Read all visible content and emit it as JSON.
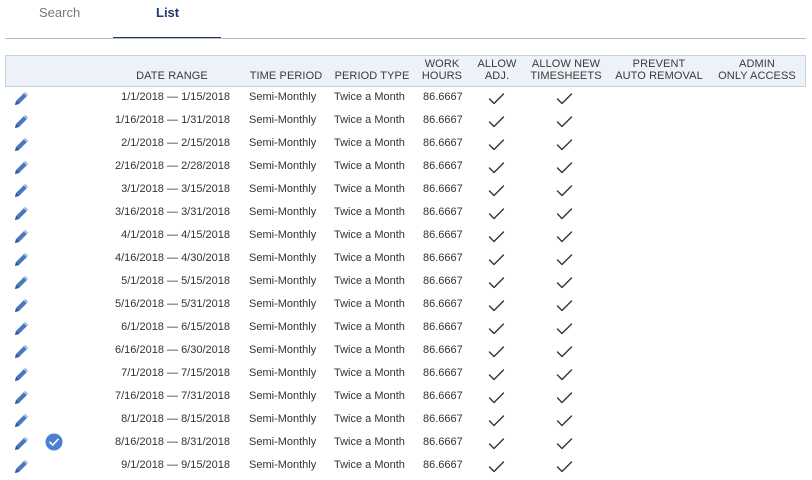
{
  "tabs": [
    {
      "label": "Search",
      "active": false
    },
    {
      "label": "List",
      "active": true
    }
  ],
  "columns": {
    "date_range": "DATE RANGE",
    "time_period": "TIME PERIOD",
    "period_type": "PERIOD TYPE",
    "work_hours": [
      "WORK",
      "HOURS"
    ],
    "allow_adj": [
      "ALLOW",
      "ADJ."
    ],
    "allow_new": [
      "ALLOW NEW",
      "TIMESHEETS"
    ],
    "prevent_auto": [
      "PREVENT",
      "AUTO REMOVAL"
    ],
    "admin_only": [
      "ADMIN",
      "ONLY ACCESS"
    ]
  },
  "colors": {
    "accent": "#1f3a6e",
    "edit_icon": "#4a78c0",
    "badge": "#4a7fd1",
    "header_bg": "#edf1f8"
  },
  "icons": {
    "edit": "pencil-icon",
    "check": "checkmark-icon",
    "badge": "check-circle-icon"
  },
  "rows": [
    {
      "start": "1/1/2018",
      "end": "1/15/2018",
      "period": "Semi-Monthly",
      "type": "Twice a Month",
      "hours": "86.6667",
      "adj": true,
      "new": true,
      "prevent": false,
      "admin": false,
      "badge": false
    },
    {
      "start": "1/16/2018",
      "end": "1/31/2018",
      "period": "Semi-Monthly",
      "type": "Twice a Month",
      "hours": "86.6667",
      "adj": true,
      "new": true,
      "prevent": false,
      "admin": false,
      "badge": false
    },
    {
      "start": "2/1/2018",
      "end": "2/15/2018",
      "period": "Semi-Monthly",
      "type": "Twice a Month",
      "hours": "86.6667",
      "adj": true,
      "new": true,
      "prevent": false,
      "admin": false,
      "badge": false
    },
    {
      "start": "2/16/2018",
      "end": "2/28/2018",
      "period": "Semi-Monthly",
      "type": "Twice a Month",
      "hours": "86.6667",
      "adj": true,
      "new": true,
      "prevent": false,
      "admin": false,
      "badge": false
    },
    {
      "start": "3/1/2018",
      "end": "3/15/2018",
      "period": "Semi-Monthly",
      "type": "Twice a Month",
      "hours": "86.6667",
      "adj": true,
      "new": true,
      "prevent": false,
      "admin": false,
      "badge": false
    },
    {
      "start": "3/16/2018",
      "end": "3/31/2018",
      "period": "Semi-Monthly",
      "type": "Twice a Month",
      "hours": "86.6667",
      "adj": true,
      "new": true,
      "prevent": false,
      "admin": false,
      "badge": false
    },
    {
      "start": "4/1/2018",
      "end": "4/15/2018",
      "period": "Semi-Monthly",
      "type": "Twice a Month",
      "hours": "86.6667",
      "adj": true,
      "new": true,
      "prevent": false,
      "admin": false,
      "badge": false
    },
    {
      "start": "4/16/2018",
      "end": "4/30/2018",
      "period": "Semi-Monthly",
      "type": "Twice a Month",
      "hours": "86.6667",
      "adj": true,
      "new": true,
      "prevent": false,
      "admin": false,
      "badge": false
    },
    {
      "start": "5/1/2018",
      "end": "5/15/2018",
      "period": "Semi-Monthly",
      "type": "Twice a Month",
      "hours": "86.6667",
      "adj": true,
      "new": true,
      "prevent": false,
      "admin": false,
      "badge": false
    },
    {
      "start": "5/16/2018",
      "end": "5/31/2018",
      "period": "Semi-Monthly",
      "type": "Twice a Month",
      "hours": "86.6667",
      "adj": true,
      "new": true,
      "prevent": false,
      "admin": false,
      "badge": false
    },
    {
      "start": "6/1/2018",
      "end": "6/15/2018",
      "period": "Semi-Monthly",
      "type": "Twice a Month",
      "hours": "86.6667",
      "adj": true,
      "new": true,
      "prevent": false,
      "admin": false,
      "badge": false
    },
    {
      "start": "6/16/2018",
      "end": "6/30/2018",
      "period": "Semi-Monthly",
      "type": "Twice a Month",
      "hours": "86.6667",
      "adj": true,
      "new": true,
      "prevent": false,
      "admin": false,
      "badge": false
    },
    {
      "start": "7/1/2018",
      "end": "7/15/2018",
      "period": "Semi-Monthly",
      "type": "Twice a Month",
      "hours": "86.6667",
      "adj": true,
      "new": true,
      "prevent": false,
      "admin": false,
      "badge": false
    },
    {
      "start": "7/16/2018",
      "end": "7/31/2018",
      "period": "Semi-Monthly",
      "type": "Twice a Month",
      "hours": "86.6667",
      "adj": true,
      "new": true,
      "prevent": false,
      "admin": false,
      "badge": false
    },
    {
      "start": "8/1/2018",
      "end": "8/15/2018",
      "period": "Semi-Monthly",
      "type": "Twice a Month",
      "hours": "86.6667",
      "adj": true,
      "new": true,
      "prevent": false,
      "admin": false,
      "badge": false
    },
    {
      "start": "8/16/2018",
      "end": "8/31/2018",
      "period": "Semi-Monthly",
      "type": "Twice a Month",
      "hours": "86.6667",
      "adj": true,
      "new": true,
      "prevent": false,
      "admin": false,
      "badge": true
    },
    {
      "start": "9/1/2018",
      "end": "9/15/2018",
      "period": "Semi-Monthly",
      "type": "Twice a Month",
      "hours": "86.6667",
      "adj": true,
      "new": true,
      "prevent": false,
      "admin": false,
      "badge": false
    }
  ]
}
